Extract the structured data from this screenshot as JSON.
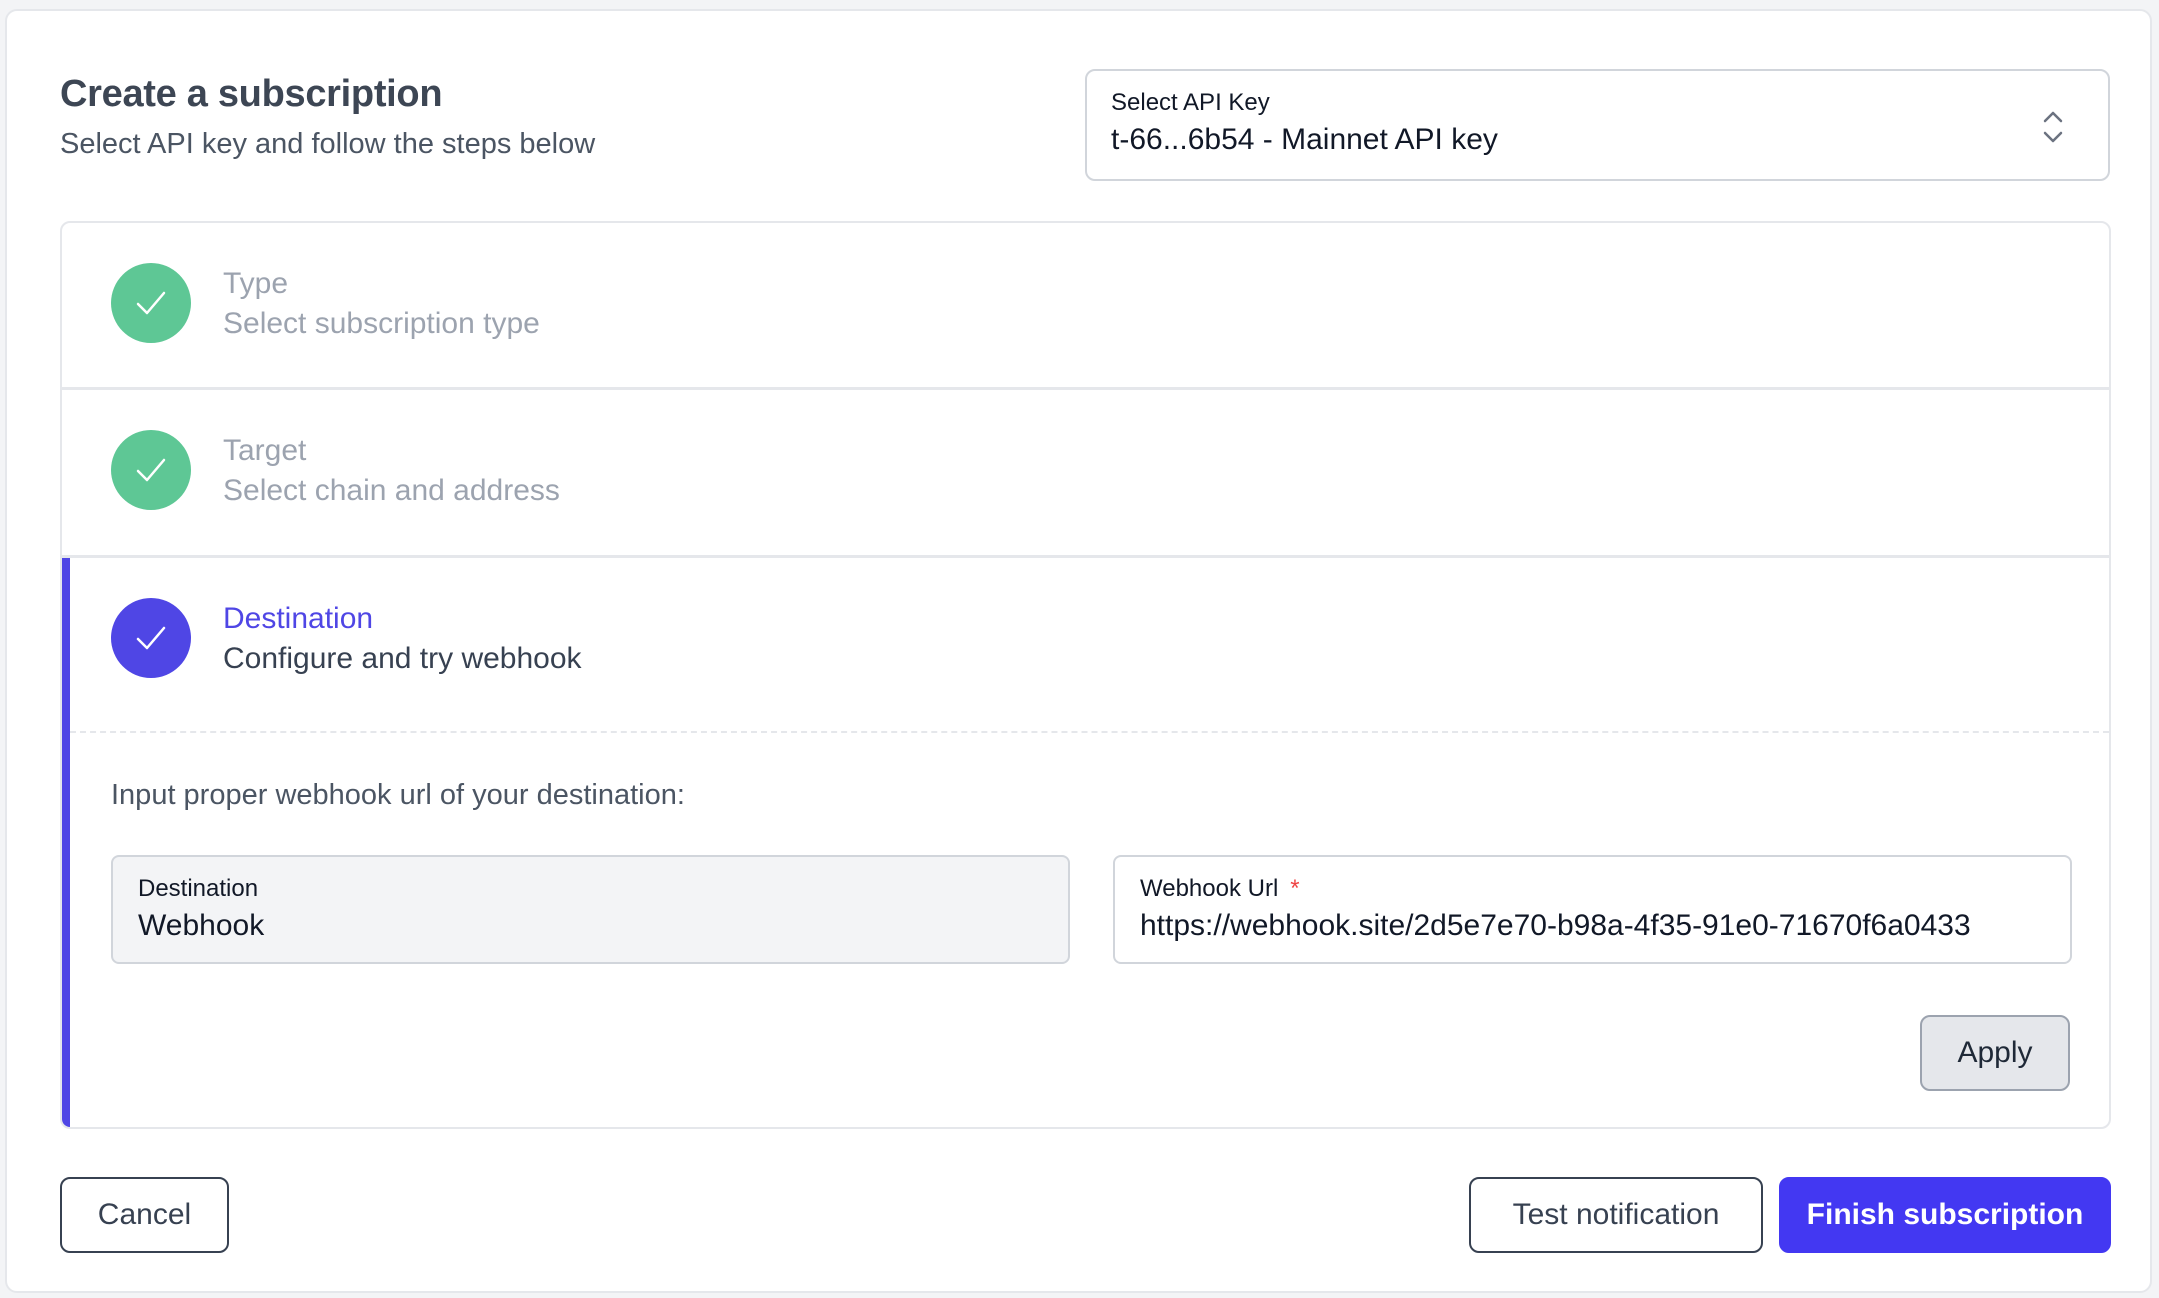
{
  "header": {
    "title": "Create a subscription",
    "subtitle": "Select API key and follow the steps below"
  },
  "api_key_select": {
    "label": "Select API Key",
    "value": "t-66...6b54 - Mainnet API key",
    "icon": "chevron-updown-icon"
  },
  "steps": [
    {
      "title": "Type",
      "subtitle": "Select subscription type",
      "status": "completed",
      "color": "#5ec795",
      "icon": "check-icon"
    },
    {
      "title": "Target",
      "subtitle": "Select chain and address",
      "status": "completed",
      "color": "#5ec795",
      "icon": "check-icon"
    },
    {
      "title": "Destination",
      "subtitle": "Configure and try webhook",
      "status": "active",
      "color": "#4f46e5",
      "icon": "check-icon"
    }
  ],
  "destination_form": {
    "instruction": "Input proper webhook url of your destination:",
    "destination": {
      "label": "Destination",
      "value": "Webhook"
    },
    "webhook_url": {
      "label": "Webhook Url",
      "required_mark": "*",
      "value": "https://webhook.site/2d5e7e70-b98a-4f35-91e0-71670f6a0433"
    },
    "apply_label": "Apply"
  },
  "footer": {
    "cancel_label": "Cancel",
    "test_label": "Test notification",
    "finish_label": "Finish subscription"
  },
  "colors": {
    "accent": "#4f46e5",
    "success": "#5ec795",
    "primary_button": "#4338f2"
  }
}
